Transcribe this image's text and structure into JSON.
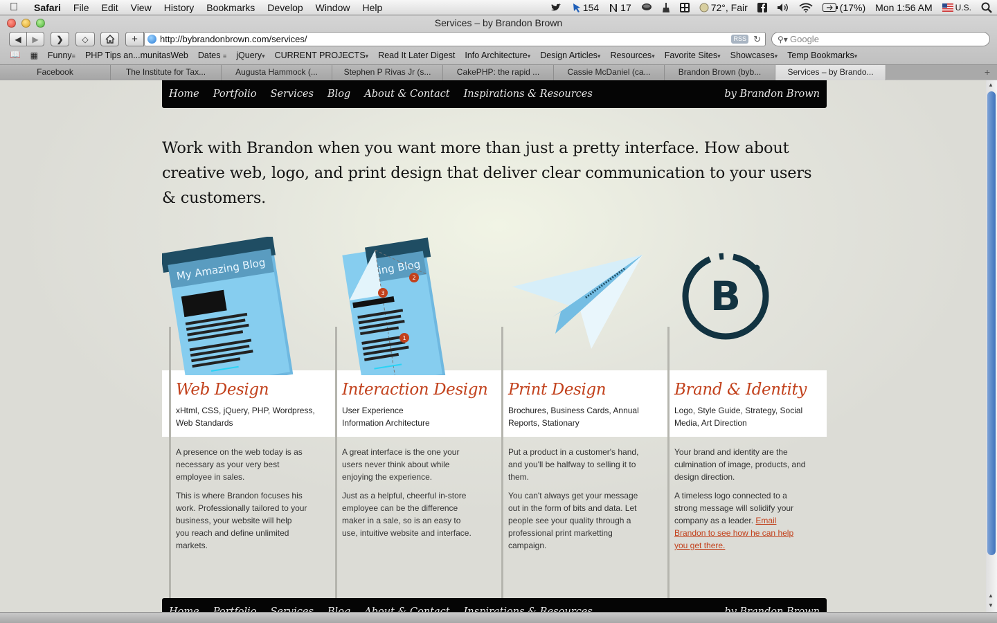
{
  "menubar": {
    "app": "Safari",
    "items": [
      "File",
      "Edit",
      "View",
      "History",
      "Bookmarks",
      "Develop",
      "Window",
      "Help"
    ],
    "status": {
      "twitter_count": "154",
      "mail_count": "17",
      "weather": "72°, Fair",
      "battery": "(17%)",
      "clock": "Mon 1:56 AM",
      "input_source": "U.S."
    }
  },
  "window": {
    "title": "Services – by Brandon Brown"
  },
  "toolbar": {
    "url": "http://bybrandonbrown.com/services/",
    "rss": "RSS",
    "search_placeholder": "Google"
  },
  "bookmarks": [
    {
      "label": "Funny",
      "menu": true
    },
    {
      "label": "PHP Tips an...munitasWeb",
      "menu": false
    },
    {
      "label": "Dates",
      "menu": true
    },
    {
      "label": "jQuery",
      "menu": true
    },
    {
      "label": "CURRENT PROJECTS",
      "menu": true
    },
    {
      "label": "Read It Later Digest",
      "menu": false
    },
    {
      "label": "Info Architecture",
      "menu": true
    },
    {
      "label": "Design Articles",
      "menu": true
    },
    {
      "label": "Resources",
      "menu": true
    },
    {
      "label": "Favorite Sites",
      "menu": true
    },
    {
      "label": "Showcases",
      "menu": true
    },
    {
      "label": "Temp Bookmarks",
      "menu": true
    }
  ],
  "tabs": [
    {
      "label": "Facebook",
      "active": false
    },
    {
      "label": "The Institute for Tax...",
      "active": false
    },
    {
      "label": "Augusta Hammock (...",
      "active": false
    },
    {
      "label": "Stephen P Rivas Jr (s...",
      "active": false
    },
    {
      "label": "CakePHP: the rapid ...",
      "active": false
    },
    {
      "label": "Cassie McDaniel (ca...",
      "active": false
    },
    {
      "label": "Brandon Brown (byb...",
      "active": false
    },
    {
      "label": "Services – by Brando...",
      "active": true
    }
  ],
  "site": {
    "nav": [
      "Home",
      "Portfolio",
      "Services",
      "Blog",
      "About & Contact",
      "Inspirations & Resources"
    ],
    "brand": "by Brandon Brown",
    "intro": "Work with Brandon when you want more than just a pretty interface. How about creative web, logo, and print design that deliver clear communication to your users & customers.",
    "illustrations": {
      "blog_title": "My Amazing Blog",
      "blog_title_partial": "ring Blog",
      "markers": [
        "3",
        "2",
        "1"
      ],
      "logo_letter": "B"
    },
    "services": [
      {
        "title": "Web Design",
        "tags": "xHtml, CSS, jQuery, PHP, Wordpress, Web Standards",
        "p1": "A presence on the web today is as necessary as your very best employee in sales.",
        "p2": "This is where Brandon focuses his work. Professionally tailored to your business, your website will help you reach and define unlimited markets."
      },
      {
        "title": "Interaction Design",
        "tags": "User Experience\nInformation Architecture",
        "p1": "A great interface is the one your users never think about while enjoying the experience.",
        "p2": "Just as a helpful, cheerful in-store employee can be the difference maker in a sale, so is an easy to use, intuitive website and interface."
      },
      {
        "title": "Print Design",
        "tags": "Brochures, Business Cards, Annual Reports, Stationary",
        "p1": "Put a product in a customer's hand, and you'll be halfway to selling it to them.",
        "p2": "You can't always get your message out in the form of bits and data. Let people see your quality through a professional print marketting campaign."
      },
      {
        "title": "Brand & Identity",
        "tags": "Logo, Style Guide, Strategy, Social Media, Art Direction",
        "p1": "Your brand and identity are the culmination of image, products, and design direction.",
        "p2": "A timeless logo connected to a strong message will solidify your company as a leader.",
        "link": "Email Brandon to see how he can help you get there."
      }
    ]
  },
  "colors": {
    "accent": "#c2411c",
    "nav_bg": "#050505",
    "paper_blue": "#7cc4ea",
    "navy": "#123341"
  }
}
